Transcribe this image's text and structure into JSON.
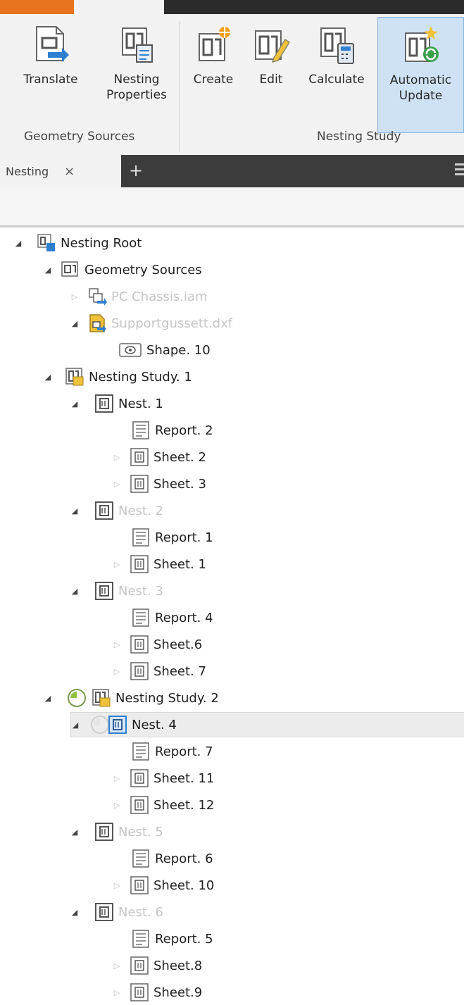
{
  "ribbon": {
    "buttons": [
      {
        "label": "Translate",
        "icon": "translate-icon"
      },
      {
        "label": "Nesting\nProperties",
        "icon": "nesting-properties-icon"
      },
      {
        "label": "Create",
        "icon": "create-nest-icon"
      },
      {
        "label": "Edit",
        "icon": "edit-nest-icon"
      },
      {
        "label": "Calculate",
        "icon": "calculate-icon"
      },
      {
        "label": "Automatic\nUpdate",
        "icon": "automatic-update-icon",
        "active": true
      }
    ],
    "groups": [
      "Geometry Sources",
      "Nesting Study"
    ]
  },
  "tabs": {
    "doc_tab": "Nesting",
    "close_glyph": "×",
    "new_glyph": "+"
  },
  "tree": {
    "nodes": [
      {
        "label": "Nesting Root",
        "icon": "nesting-root-icon"
      },
      {
        "label": "Geometry Sources",
        "icon": "geometry-sources-icon"
      },
      {
        "label": "PC Chassis.iam",
        "icon": "assembly-icon",
        "dim": true
      },
      {
        "label": "Supportgussett.dxf",
        "icon": "dxf-file-icon",
        "dim": true
      },
      {
        "label": "Shape. 10",
        "icon": "shape-icon"
      },
      {
        "label": "Nesting Study. 1",
        "icon": "nesting-study-icon"
      },
      {
        "label": "Nest. 1",
        "icon": "nest-icon"
      },
      {
        "label": "Report. 2",
        "icon": "report-icon"
      },
      {
        "label": "Sheet. 2",
        "icon": "sheet-icon"
      },
      {
        "label": "Sheet. 3",
        "icon": "sheet-icon"
      },
      {
        "label": "Nest. 2",
        "icon": "nest-icon",
        "dim": true
      },
      {
        "label": "Report. 1",
        "icon": "report-icon"
      },
      {
        "label": "Sheet. 1",
        "icon": "sheet-icon"
      },
      {
        "label": "Nest. 3",
        "icon": "nest-icon",
        "dim": true
      },
      {
        "label": "Report. 4",
        "icon": "report-icon"
      },
      {
        "label": "Sheet.6",
        "icon": "sheet-icon"
      },
      {
        "label": "Sheet. 7",
        "icon": "sheet-icon"
      },
      {
        "label": "Nesting Study. 2",
        "icon": "nesting-study-icon"
      },
      {
        "label": "Nest. 4",
        "icon": "nest-icon",
        "selected": true
      },
      {
        "label": "Report. 7",
        "icon": "report-icon"
      },
      {
        "label": "Sheet. 11",
        "icon": "sheet-icon"
      },
      {
        "label": "Sheet. 12",
        "icon": "sheet-icon"
      },
      {
        "label": "Nest. 5",
        "icon": "nest-icon",
        "dim": true
      },
      {
        "label": "Report. 6",
        "icon": "report-icon"
      },
      {
        "label": "Sheet. 10",
        "icon": "sheet-icon"
      },
      {
        "label": "Nest. 6",
        "icon": "nest-icon",
        "dim": true
      },
      {
        "label": "Report. 5",
        "icon": "report-icon"
      },
      {
        "label": "Sheet.8",
        "icon": "sheet-icon"
      },
      {
        "label": "Sheet.9",
        "icon": "sheet-icon"
      }
    ]
  },
  "colors": {
    "accent_blue": "#2f7fd0",
    "active_button": "#cfe2f5",
    "tab_bar": "#3c3c3c",
    "highlight_yellow": "#f0c23a",
    "progress_green": "#8fc23f"
  }
}
